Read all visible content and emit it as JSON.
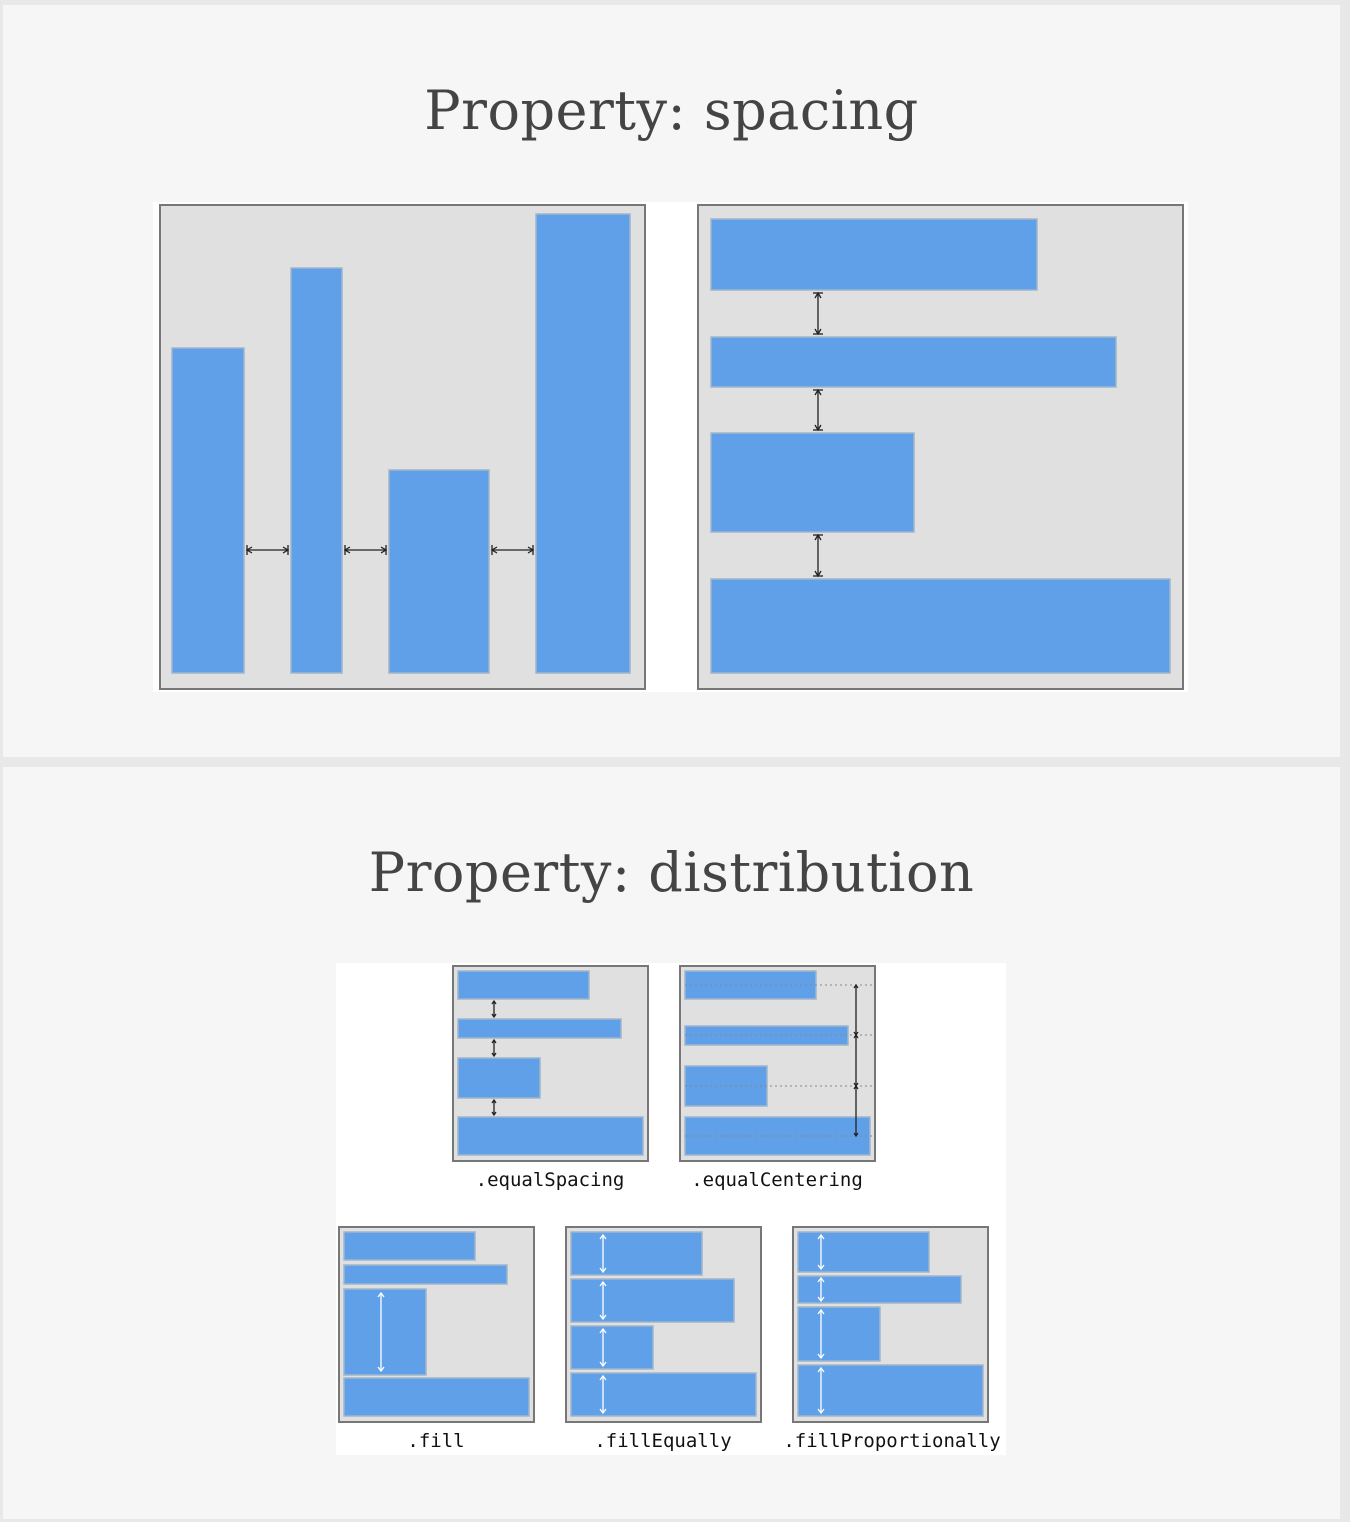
{
  "slides": [
    {
      "title": "Property: spacing"
    },
    {
      "title": "Property: distribution"
    }
  ],
  "distribution_labels": {
    "equal_spacing": ".equalSpacing",
    "equal_centering": ".equalCentering",
    "fill": ".fill",
    "fill_equally": ".fillEqually",
    "fill_proportionally": ".fillProportionally"
  },
  "colors": {
    "bar": "#5fa0e8",
    "panel": "#e0e0e0",
    "slide_background": "#f6f6f6",
    "title_text": "#444444"
  }
}
